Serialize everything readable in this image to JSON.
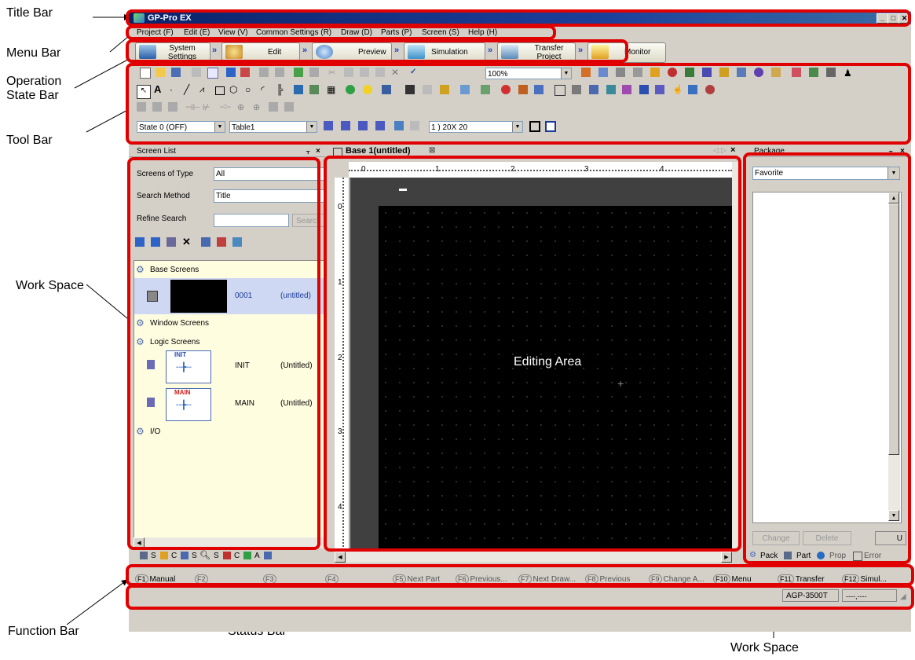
{
  "callouts": {
    "title_bar": "Title Bar",
    "menu_bar": "Menu Bar",
    "operation_state_bar_1": "Operation",
    "operation_state_bar_2": "State Bar",
    "tool_bar": "Tool Bar",
    "work_space_left": "Work Space",
    "function_bar": "Function Bar",
    "status_bar": "Status Bar",
    "work_space_right": "Work Space"
  },
  "window": {
    "title": "GP-Pro EX"
  },
  "menu": [
    "Project (F)",
    "Edit (E)",
    "View (V)",
    "Common Settings (R)",
    "Draw (D)",
    "Parts (P)",
    "Screen (S)",
    "Help (H)"
  ],
  "operation_states": {
    "system_settings_1": "System",
    "system_settings_2": "Settings",
    "edit": "Edit",
    "preview": "Preview",
    "simulation": "Simulation",
    "transfer_1": "Transfer",
    "transfer_2": "Project",
    "monitor": "Monitor"
  },
  "toolbar": {
    "zoom": "100%",
    "state": "State 0 (OFF)",
    "table": "Table1",
    "grid": "1 ) 20X 20"
  },
  "screen_list": {
    "header": "Screen List",
    "screens_of_type_label": "Screens of Type",
    "screens_of_type_value": "All",
    "search_method_label": "Search Method",
    "search_method_value": "Title",
    "refine_search_label": "Refine Search",
    "search_button": "Search",
    "base_screens": "Base Screens",
    "base_row_number": "0001",
    "base_row_title": "(untitled)",
    "window_screens": "Window Screens",
    "logic_screens": "Logic Screens",
    "logic1_thumb": "INIT",
    "logic1_name": "INIT",
    "logic1_title": "(Untitled)",
    "logic2_thumb": "MAIN",
    "logic2_name": "MAIN",
    "logic2_title": "(Untitled)",
    "io": "I/O",
    "bottom_tabs": [
      "S",
      "C",
      "S",
      "S",
      "C",
      "A"
    ]
  },
  "editor": {
    "tab_title": "Base 1(untitled)",
    "ruler_top": [
      "0",
      "1",
      "2",
      "3",
      "4"
    ],
    "ruler_left": [
      "0",
      "1",
      "2",
      "3",
      "4"
    ],
    "editing_area_label": "Editing Area"
  },
  "package": {
    "header": "Package",
    "category": "Favorite",
    "change_button": "Change",
    "delete_button": "Delete",
    "u_button": "U",
    "tabs": [
      "Pack",
      "Part",
      "Prop",
      "Error"
    ]
  },
  "function_bar": {
    "keys": [
      {
        "key": "F1",
        "label": "Manual",
        "enabled": true
      },
      {
        "key": "F2",
        "label": "",
        "enabled": false
      },
      {
        "key": "F3",
        "label": "",
        "enabled": false
      },
      {
        "key": "F4",
        "label": "",
        "enabled": false
      },
      {
        "key": "F5",
        "label": "Next Part",
        "enabled": false
      },
      {
        "key": "F6",
        "label": "Previous...",
        "enabled": false
      },
      {
        "key": "F7",
        "label": "Next Draw...",
        "enabled": false
      },
      {
        "key": "F8",
        "label": "Previous",
        "enabled": false
      },
      {
        "key": "F9",
        "label": "Change A...",
        "enabled": false
      },
      {
        "key": "F10",
        "label": "Menu",
        "enabled": true
      },
      {
        "key": "F11",
        "label": "Transfer",
        "enabled": true
      },
      {
        "key": "F12",
        "label": "Simul...",
        "enabled": true
      }
    ]
  },
  "status_bar": {
    "model": "AGP-3500T",
    "position": "----,----"
  }
}
